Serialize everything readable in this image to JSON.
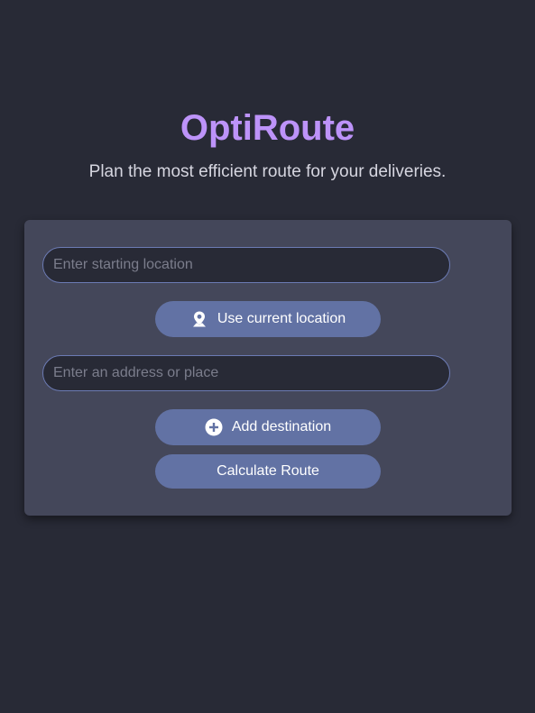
{
  "header": {
    "title": "OptiRoute",
    "subtitle": "Plan the most efficient route for your deliveries."
  },
  "form": {
    "start_placeholder": "Enter starting location",
    "start_value": "",
    "current_location_label": "Use current location",
    "current_location_icon": "map-pin-icon",
    "destination_placeholder": "Enter an address or place",
    "destination_value": "",
    "add_destination_label": "Add destination",
    "add_destination_icon": "plus-circle-icon",
    "calculate_label": "Calculate Route"
  },
  "colors": {
    "background": "#282a36",
    "card": "#44475a",
    "accent": "#bd93f9",
    "button": "#6272a4"
  }
}
